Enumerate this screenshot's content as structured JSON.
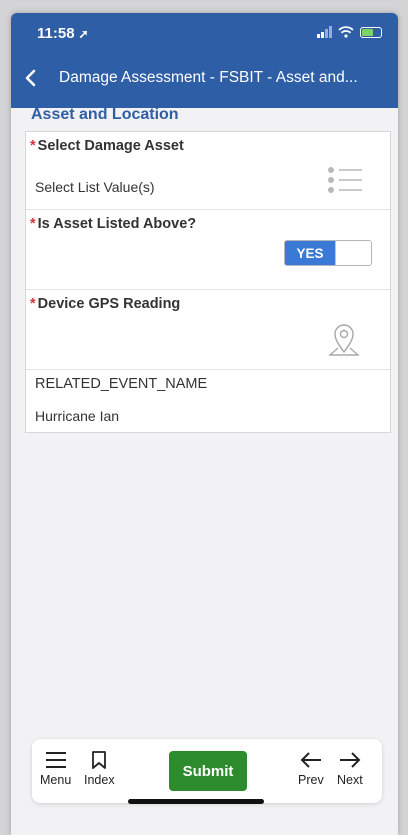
{
  "status": {
    "time": "11:58",
    "location_glyph": "➚",
    "battery_color": "#7bd36a"
  },
  "nav": {
    "back_glyph": "<",
    "title": "Damage Assessment - FSBIT - Asset and..."
  },
  "section": {
    "title": "Asset and Location"
  },
  "fields": {
    "damage_asset": {
      "label": "Select Damage Asset",
      "required": "*",
      "value": "Select List Value(s)",
      "icon": "list-icon"
    },
    "asset_listed": {
      "label": "Is Asset Listed Above?",
      "required": "*",
      "toggle_label": "YES",
      "toggle_state": "on"
    },
    "gps": {
      "label": "Device GPS Reading",
      "required": "*",
      "icon": "map-pin-icon"
    },
    "related_event": {
      "label": "RELATED_EVENT_NAME",
      "value": "Hurricane Ian"
    }
  },
  "bottom_bar": {
    "menu": "Menu",
    "index": "Index",
    "submit": "Submit",
    "prev": "Prev",
    "next": "Next"
  },
  "colors": {
    "header": "#2e5ea6",
    "submit": "#2c8b2d",
    "toggle": "#3b79d6",
    "required": "#d8313a"
  }
}
